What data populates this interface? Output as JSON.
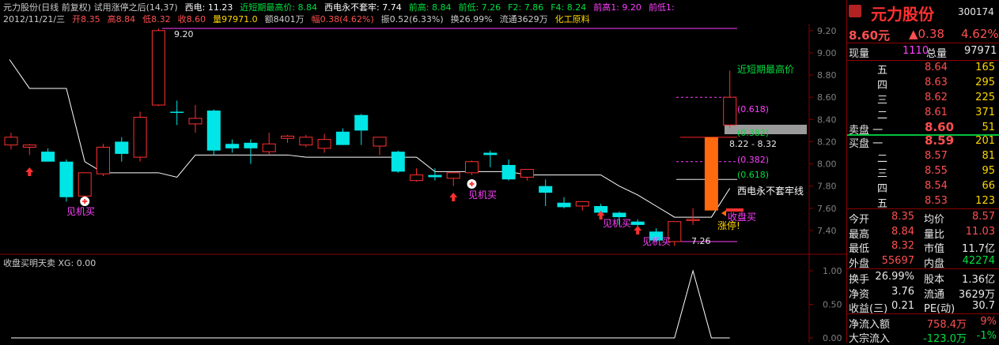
{
  "header": {
    "line1": [
      {
        "text": "元力股份(日线 前复权) 试用涨停之后(14,37)",
        "color": "#cccccc"
      },
      {
        "text": "西电: 11.23",
        "color": "#ffffff"
      },
      {
        "text": "近短期最高价: 8.84",
        "color": "#00e040"
      },
      {
        "text": "西电永不套牢: 7.74",
        "color": "#ffffff"
      },
      {
        "text": "前高: 8.84",
        "color": "#00e040"
      },
      {
        "text": "前低: 7.26",
        "color": "#00e040"
      },
      {
        "text": "F2: 7.86",
        "color": "#00e040"
      },
      {
        "text": "F4: 8.24",
        "color": "#00e040"
      },
      {
        "text": "前高1: 9.20",
        "color": "#ff40ff"
      },
      {
        "text": "前低1:",
        "color": "#ff40ff"
      }
    ],
    "line2": [
      {
        "text": "2012/11/21/三",
        "color": "#cccccc"
      },
      {
        "text": "开8.35",
        "color": "#ff5050"
      },
      {
        "text": "高8.84",
        "color": "#ff5050"
      },
      {
        "text": "低8.32",
        "color": "#ff5050"
      },
      {
        "text": "收8.60",
        "color": "#ff5050"
      },
      {
        "text": "量97971.0",
        "color": "#ffd700"
      },
      {
        "text": "额8401万",
        "color": "#cccccc"
      },
      {
        "text": "幅0.38(4.62%)",
        "color": "#ff5050"
      },
      {
        "text": "振0.52(6.33%)",
        "color": "#cccccc"
      },
      {
        "text": "换26.99%",
        "color": "#cccccc"
      },
      {
        "text": "流通3629万",
        "color": "#cccccc"
      },
      {
        "text": "化工原料",
        "color": "#ffd700"
      }
    ]
  },
  "price_axis": [
    "9.20",
    "9.00",
    "8.80",
    "8.60",
    "8.40",
    "8.20",
    "8.00",
    "7.80",
    "7.60",
    "7.40"
  ],
  "indicator_axis": [
    "1.00",
    "0.50",
    "0.00"
  ],
  "indicator_title": "收盘买明天卖  XG: 0.00",
  "annotations": {
    "high_920": "9.20",
    "recent_high": "近短期最高价",
    "fib_618_top": "(0.618)",
    "fib_382_top": "(0.382)",
    "range": "8.22 - 8.32",
    "fib_382": "(0.382)",
    "fib_618": "(0.618)",
    "xidian_label": "西电永不套牢线",
    "close_buy": "收盘买",
    "limit_up": "涨停!",
    "low_726": "7.26",
    "buy_signal": "见机买"
  },
  "chart_data": {
    "type": "candlestick",
    "ylim": [
      7.3,
      9.25
    ],
    "candles": [
      {
        "o": 8.17,
        "h": 8.28,
        "l": 8.13,
        "c": 8.24
      },
      {
        "o": 8.15,
        "h": 8.18,
        "l": 8.08,
        "c": 8.17
      },
      {
        "o": 8.11,
        "h": 8.14,
        "l": 8.08,
        "c": 8.02
      },
      {
        "o": 8.02,
        "h": 8.04,
        "l": 7.66,
        "c": 7.7
      },
      {
        "o": 7.71,
        "h": 7.92,
        "l": 7.68,
        "c": 7.92
      },
      {
        "o": 7.91,
        "h": 8.18,
        "l": 7.89,
        "c": 8.15
      },
      {
        "o": 8.2,
        "h": 8.24,
        "l": 8.02,
        "c": 8.09
      },
      {
        "o": 8.06,
        "h": 8.47,
        "l": 8.02,
        "c": 8.42
      },
      {
        "o": 8.53,
        "h": 9.22,
        "l": 8.52,
        "c": 9.2
      },
      {
        "o": 8.47,
        "h": 8.57,
        "l": 8.35,
        "c": 8.46
      },
      {
        "o": 8.36,
        "h": 8.53,
        "l": 8.28,
        "c": 8.41
      },
      {
        "o": 8.48,
        "h": 8.49,
        "l": 8.08,
        "c": 8.12
      },
      {
        "o": 8.18,
        "h": 8.22,
        "l": 8.1,
        "c": 8.14
      },
      {
        "o": 8.19,
        "h": 8.22,
        "l": 8.0,
        "c": 8.14
      },
      {
        "o": 8.11,
        "h": 8.28,
        "l": 8.08,
        "c": 8.18
      },
      {
        "o": 8.23,
        "h": 8.26,
        "l": 8.19,
        "c": 8.25
      },
      {
        "o": 8.17,
        "h": 8.26,
        "l": 8.15,
        "c": 8.24
      },
      {
        "o": 8.14,
        "h": 8.27,
        "l": 8.1,
        "c": 8.22
      },
      {
        "o": 8.29,
        "h": 8.32,
        "l": 8.17,
        "c": 8.17
      },
      {
        "o": 8.44,
        "h": 8.45,
        "l": 8.17,
        "c": 8.3
      },
      {
        "o": 8.16,
        "h": 8.24,
        "l": 8.08,
        "c": 8.24
      },
      {
        "o": 8.11,
        "h": 8.12,
        "l": 7.92,
        "c": 7.93
      },
      {
        "o": 7.85,
        "h": 7.96,
        "l": 7.84,
        "c": 7.9
      },
      {
        "o": 7.9,
        "h": 7.96,
        "l": 7.85,
        "c": 7.88
      },
      {
        "o": 7.87,
        "h": 7.93,
        "l": 7.8,
        "c": 7.92
      },
      {
        "o": 7.92,
        "h": 8.03,
        "l": 7.9,
        "c": 8.02
      },
      {
        "o": 8.1,
        "h": 8.12,
        "l": 7.97,
        "c": 8.08
      },
      {
        "o": 7.99,
        "h": 8.04,
        "l": 7.85,
        "c": 7.86
      },
      {
        "o": 7.88,
        "h": 7.95,
        "l": 7.85,
        "c": 7.95
      },
      {
        "o": 7.8,
        "h": 7.86,
        "l": 7.62,
        "c": 7.74
      },
      {
        "o": 7.65,
        "h": 7.7,
        "l": 7.6,
        "c": 7.61
      },
      {
        "o": 7.62,
        "h": 7.66,
        "l": 7.58,
        "c": 7.66
      },
      {
        "o": 7.62,
        "h": 7.64,
        "l": 7.54,
        "c": 7.56
      },
      {
        "o": 7.56,
        "h": 7.57,
        "l": 7.45,
        "c": 7.52
      },
      {
        "o": 7.48,
        "h": 7.5,
        "l": 7.4,
        "c": 7.45
      },
      {
        "o": 7.39,
        "h": 7.42,
        "l": 7.3,
        "c": 7.31
      },
      {
        "o": 7.3,
        "h": 7.48,
        "l": 7.26,
        "c": 7.48
      },
      {
        "o": 7.5,
        "h": 7.6,
        "l": 7.45,
        "c": 7.5
      },
      {
        "o": 7.58,
        "h": 8.24,
        "l": 7.58,
        "c": 8.24
      },
      {
        "o": 8.35,
        "h": 8.84,
        "l": 8.32,
        "c": 8.6
      }
    ],
    "line": [
      8.94,
      8.68,
      8.68,
      8.68,
      8.02,
      7.92,
      7.92,
      7.92,
      7.92,
      7.88,
      8.08,
      8.08,
      8.08,
      8.08,
      8.08,
      8.08,
      8.06,
      8.06,
      8.06,
      8.06,
      8.06,
      8.06,
      8.06,
      7.93,
      7.93,
      7.93,
      7.93,
      7.93,
      7.9,
      7.9,
      7.9,
      7.9,
      7.9,
      7.8,
      7.72,
      7.62,
      7.52,
      7.52,
      7.52,
      7.78
    ],
    "indicator": [
      0,
      0,
      0,
      0,
      0,
      0,
      0,
      0,
      0,
      0,
      0,
      0,
      0,
      0,
      0,
      0,
      0,
      0,
      0,
      0,
      0,
      0,
      0,
      0,
      0,
      0,
      0,
      0,
      0,
      0,
      0,
      0,
      0,
      0,
      0,
      0,
      0,
      1,
      0,
      0
    ]
  },
  "quote": {
    "name": "元力股份",
    "code": "300174",
    "price": "8.60元",
    "change": "▲0.38",
    "pct": "4.62%",
    "now_vol_label": "现量",
    "now_vol": "1110",
    "total_vol_label": "总量",
    "total_vol": "97971",
    "sell": [
      {
        "label": "五",
        "price": "8.64",
        "vol": "165"
      },
      {
        "label": "四",
        "price": "8.63",
        "vol": "295"
      },
      {
        "label": "三",
        "price": "8.62",
        "vol": "225"
      },
      {
        "label": "二",
        "price": "8.61",
        "vol": "371"
      },
      {
        "label": "卖盘 一",
        "price": "8.60",
        "vol": "51"
      }
    ],
    "buy": [
      {
        "label": "买盘 一",
        "price": "8.59",
        "vol": "201"
      },
      {
        "label": "二",
        "price": "8.57",
        "vol": "81"
      },
      {
        "label": "三",
        "price": "8.55",
        "vol": "95"
      },
      {
        "label": "四",
        "price": "8.54",
        "vol": "66"
      },
      {
        "label": "五",
        "price": "8.53",
        "vol": "123"
      }
    ],
    "stats": [
      {
        "l1": "今开",
        "v1": "8.35",
        "c1": "#ff5050",
        "l2": "均价",
        "v2": "8.57",
        "c2": "#ff5050"
      },
      {
        "l1": "最高",
        "v1": "8.84",
        "c1": "#ff5050",
        "l2": "量比",
        "v2": "11.03",
        "c2": "#ff5050"
      },
      {
        "l1": "最低",
        "v1": "8.32",
        "c1": "#ff5050",
        "l2": "市值",
        "v2": "11.7亿",
        "c2": "#e8e8e8"
      },
      {
        "l1": "外盘",
        "v1": "55697",
        "c1": "#ff5050",
        "l2": "内盘",
        "v2": "42274",
        "c2": "#00e040"
      }
    ],
    "stats2": [
      {
        "l1": "换手",
        "v1": "26.99%",
        "l2": "股本",
        "v2": "1.36亿"
      },
      {
        "l1": "净资",
        "v1": "3.76",
        "l2": "流通",
        "v2": "3629万"
      },
      {
        "l1": "收益(三)",
        "v1": "0.21",
        "l2": "PE(动)",
        "v2": "30.7"
      }
    ],
    "flow": [
      {
        "label": "净流入额",
        "value": "758.4万",
        "pct": "9%",
        "color": "#ff5050"
      },
      {
        "label": "大宗流入",
        "value": "-123.0万",
        "pct": "-1%",
        "color": "#00e040"
      }
    ]
  }
}
